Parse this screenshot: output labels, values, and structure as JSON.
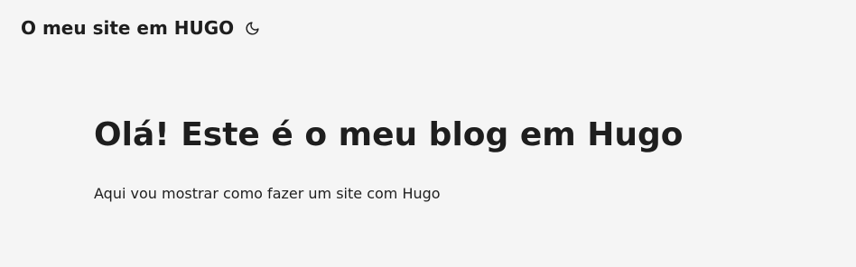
{
  "header": {
    "site_title": "O meu site em HUGO",
    "theme_icon": "moon-icon"
  },
  "main": {
    "title": "Olá! Este é o meu blog em Hugo",
    "intro": "Aqui vou mostrar como fazer um site com Hugo"
  },
  "colors": {
    "background": "#f5f5f5",
    "text": "#1e1e1e"
  }
}
